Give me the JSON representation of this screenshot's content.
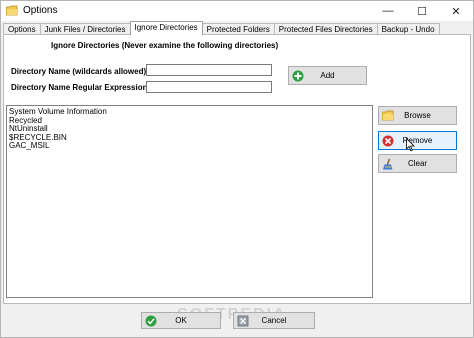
{
  "window": {
    "title": "Options",
    "controls": {
      "minimize": "—",
      "maximize": "☐",
      "close": "✕"
    }
  },
  "tabs": [
    {
      "label": "Options"
    },
    {
      "label": "Junk Files / Directories"
    },
    {
      "label": "Ignore Directories",
      "active": true
    },
    {
      "label": "Protected Folders"
    },
    {
      "label": "Protected Files Directories"
    },
    {
      "label": "Backup - Undo"
    }
  ],
  "ignore_directories": {
    "heading": "Ignore Directories (Never examine the following directories)",
    "directory_name_label": "Directory Name (wildcards allowed) :",
    "directory_name_value": "",
    "regex_label": "Directory Name Regular Expression :",
    "regex_value": "",
    "add_label": "Add",
    "browse_label": "Browse",
    "remove_label": "Remove",
    "clear_label": "Clear",
    "list_items": [
      "System Volume Information",
      "Recycled",
      "NtUninstall",
      "$RECYCLE.BIN",
      "GAC_MSIL"
    ]
  },
  "footer": {
    "ok_label": "OK",
    "cancel_label": "Cancel"
  },
  "watermark": "SOFTPEDIA",
  "icons": {
    "app": "folder-icon",
    "add": "plus-circle-icon",
    "browse": "folder-icon",
    "remove": "x-circle-icon",
    "clear": "broom-icon",
    "ok": "check-icon",
    "cancel": "cancel-icon"
  },
  "colors": {
    "add_green": "#2e9e3e",
    "remove_red": "#d43030",
    "folder_yellow": "#f2c94c",
    "focus_blue": "#0078d7"
  }
}
